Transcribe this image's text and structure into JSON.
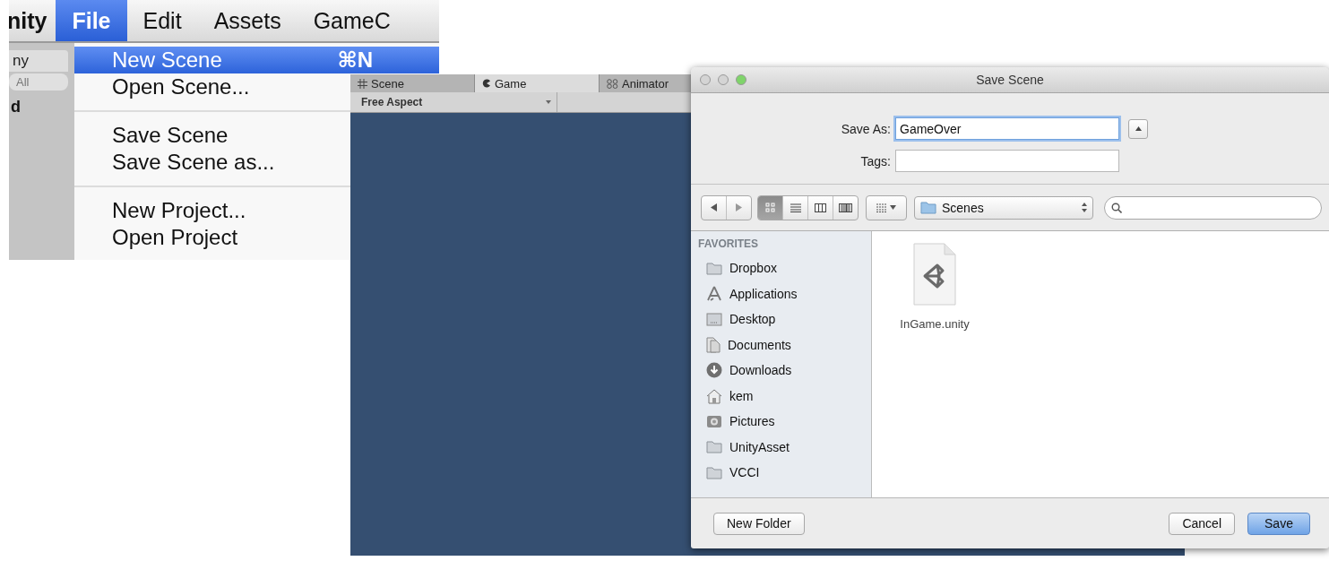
{
  "menu_bar": {
    "app_name": "nity",
    "items": [
      {
        "label": "File",
        "selected": true
      },
      {
        "label": "Edit",
        "selected": false
      },
      {
        "label": "Assets",
        "selected": false
      },
      {
        "label": "GameC",
        "selected": false
      }
    ]
  },
  "hierarchy": {
    "tab": "ny",
    "search": "All",
    "row": "d"
  },
  "file_menu": {
    "items": [
      {
        "kind": "item",
        "label": "New Scene",
        "shortcut": "⌘N",
        "selected": true
      },
      {
        "kind": "item",
        "label": "Open Scene...",
        "selected": false
      },
      {
        "kind": "separator"
      },
      {
        "kind": "item",
        "label": "Save Scene",
        "selected": false
      },
      {
        "kind": "item",
        "label": "Save Scene as...",
        "selected": false
      },
      {
        "kind": "separator"
      },
      {
        "kind": "item",
        "label": "New Project...",
        "selected": false
      },
      {
        "kind": "item",
        "label": "Open Project",
        "selected": false
      }
    ]
  },
  "editor": {
    "tabs": [
      {
        "kind": "scene",
        "label": "Scene",
        "selected": false
      },
      {
        "kind": "game",
        "label": "Game",
        "selected": true
      },
      {
        "kind": "animator",
        "label": "Animator",
        "selected": false
      }
    ],
    "aspect": "Free Aspect"
  },
  "dialog": {
    "title": "Save Scene",
    "save_as": {
      "label": "Save As:",
      "value": "GameOver"
    },
    "tags": {
      "label": "Tags:"
    },
    "view_modes": [
      {
        "kind": "icons",
        "selected": true
      },
      {
        "kind": "list",
        "selected": false
      },
      {
        "kind": "columns",
        "selected": false
      },
      {
        "kind": "coverflow",
        "selected": false
      }
    ],
    "location": "Scenes",
    "sidebar": {
      "heading": "FAVORITES",
      "items": [
        {
          "kind": "folder",
          "label": "Dropbox"
        },
        {
          "kind": "apps",
          "label": "Applications"
        },
        {
          "kind": "desktop",
          "label": "Desktop"
        },
        {
          "kind": "documents",
          "label": "Documents"
        },
        {
          "kind": "downloads",
          "label": "Downloads"
        },
        {
          "kind": "home",
          "label": "kem"
        },
        {
          "kind": "pictures",
          "label": "Pictures"
        },
        {
          "kind": "folder",
          "label": "UnityAsset"
        },
        {
          "kind": "folder",
          "label": "VCCI"
        }
      ]
    },
    "files": [
      {
        "name": "InGame.unity"
      }
    ],
    "buttons": [
      {
        "kind": "secondary",
        "label": "New Folder"
      },
      {
        "kind": "secondary",
        "label": "Cancel"
      },
      {
        "kind": "default",
        "label": "Save"
      }
    ]
  }
}
